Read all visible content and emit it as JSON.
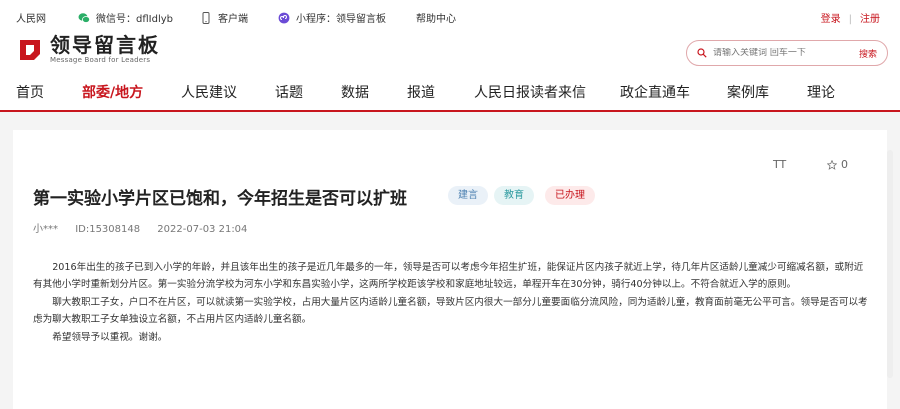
{
  "topbar": {
    "site": "人民网",
    "wechat": "微信号：dflIdlyb",
    "client": "客户端",
    "miniprogram": "小程序：领导留言板",
    "help": "帮助中心",
    "login": "登录",
    "register": "注册"
  },
  "header": {
    "logo_cn": "领导留言板",
    "logo_en": "Message Board for Leaders",
    "search_placeholder": "请输入关键词 回车一下",
    "search_button": "搜索"
  },
  "nav": {
    "items": [
      "首页",
      "部委/地方",
      "人民建议",
      "话题",
      "数据",
      "报道",
      "人民日报读者来信",
      "政企直通车",
      "案例库",
      "理论"
    ],
    "active_index": 1
  },
  "post": {
    "font_toggle": "TT",
    "favorite_count": "0",
    "title": "第一实验小学片区已饱和，今年招生是否可以扩班",
    "tags": [
      "建言",
      "教育",
      "已办理"
    ],
    "author": "小***",
    "id": "ID:15308148",
    "date": "2022-07-03 21:04",
    "paragraphs": [
      "2016年出生的孩子已到入小学的年龄，并且该年出生的孩子是近几年最多的一年，领导是否可以考虑今年招生扩班，能保证片区内孩子就近上学，待几年片区适龄儿童减少可缩减名额，或附近有其他小学时重新划分片区。第一实验分流学校为河东小学和东昌实验小学，这两所学校距该学校和家庭地址较远，单程开车在30分钟，骑行40分钟以上。不符合就近入学的原则。",
      "聊大教职工子女，户口不在片区，可以就读第一实验学校，占用大量片区内适龄儿童名额，导致片区内很大一部分儿童要面临分流风险，同为适龄儿童，教育面前毫无公平可言。领导是否可以考虑为聊大教职工子女单独设立名额，不占用片区内适龄儿童名额。",
      "希望领导予以重视。谢谢。"
    ]
  },
  "colors": {
    "brand": "#c8161e"
  }
}
